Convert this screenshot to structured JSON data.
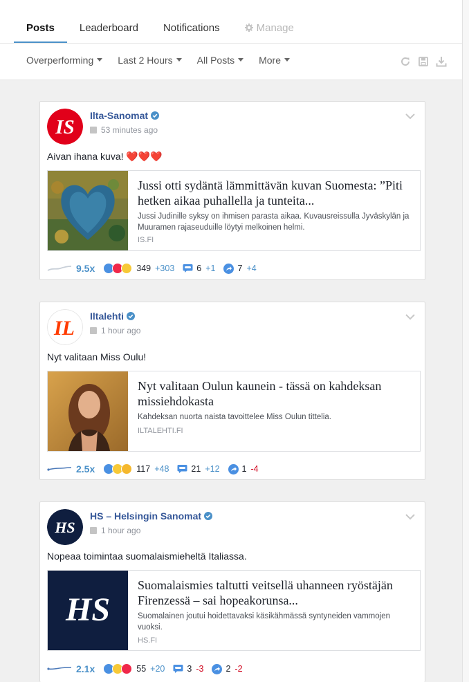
{
  "tabs": [
    {
      "label": "Posts",
      "active": true
    },
    {
      "label": "Leaderboard",
      "active": false
    },
    {
      "label": "Notifications",
      "active": false
    },
    {
      "label": "Manage",
      "active": false,
      "disabled": true
    }
  ],
  "filters": [
    "Overperforming",
    "Last 2 Hours",
    "All Posts",
    "More"
  ],
  "tools": [
    "refresh-icon",
    "save-icon",
    "download-icon"
  ],
  "colors": {
    "link_blue": "#365899",
    "accent": "#4a90c8",
    "negative": "#d0021b"
  },
  "posts": [
    {
      "page": "Ilta-Sanomat",
      "logo_text": "IS",
      "time": "53 minutes ago",
      "text": "Aivan ihana kuva! ❤️❤️❤️",
      "link": {
        "title": "Jussi otti sydäntä lämmittävän kuvan Suomesta: ”Piti hetken aikaa puhallella ja tunteita...",
        "description": "Jussi Judinille syksy on ihmisen parasta aikaa. Kuvausreissulla Jyväskylän ja Muuramen rajaseuduille löytyi melkoinen helmi.",
        "domain": "IS.FI"
      },
      "ratio": "9.5x",
      "reactions": "349",
      "reactions_delta": "+303",
      "comments": "6",
      "comments_delta": "+1",
      "shares": "7",
      "shares_delta": "+4"
    },
    {
      "page": "Iltalehti",
      "logo_text": "IL",
      "time": "1 hour ago",
      "text": "Nyt valitaan Miss Oulu!",
      "link": {
        "title": "Nyt valitaan Oulun kaunein - tässä on kahdeksan missiehdokasta",
        "description": "Kahdeksan nuorta naista tavoittelee Miss Oulun tittelia.",
        "domain": "ILTALEHTI.FI"
      },
      "ratio": "2.5x",
      "reactions": "117",
      "reactions_delta": "+48",
      "comments": "21",
      "comments_delta": "+12",
      "shares": "1",
      "shares_delta": "-4"
    },
    {
      "page": "HS – Helsingin Sanomat",
      "logo_text": "HS",
      "time": "1 hour ago",
      "text": "Nopeaa toimintaa suomalaismieheltä Italiassa.",
      "link": {
        "title": "Suomalaismies taltutti veitsellä uhanneen ryöstäjän Firenzessä – sai hopeakorunsa...",
        "description": "Suomalainen joutui hoidettavaksi käsikähmässä syntyneiden vammojen vuoksi.",
        "domain": "HS.FI"
      },
      "ratio": "2.1x",
      "reactions": "55",
      "reactions_delta": "+20",
      "comments": "3",
      "comments_delta": "-3",
      "shares": "2",
      "shares_delta": "-2"
    }
  ]
}
